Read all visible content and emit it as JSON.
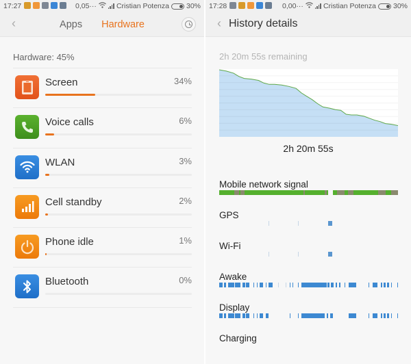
{
  "left_screen": {
    "status_bar": {
      "time": "17:27",
      "notifications": [
        {
          "name": "game-notification-icon",
          "color": "#d89a2a"
        },
        {
          "name": "orange-app-notification-icon",
          "color": "#f0973a"
        },
        {
          "name": "gray-app-notification-icon",
          "color": "#7e8794"
        },
        {
          "name": "blue-app-notification-icon",
          "color": "#3b86d6"
        },
        {
          "name": "message-notification-icon",
          "color": "#6b7d92"
        }
      ],
      "data_speed": "0,05···",
      "carrier": "Cristian Potenza",
      "battery": "30%"
    },
    "header": {
      "back_icon": "‹",
      "tabs": [
        {
          "label": "Apps",
          "active": false
        },
        {
          "label": "Hardware",
          "active": true
        }
      ],
      "history_icon": "clock-icon"
    },
    "section_label": "Hardware: 45%",
    "items": [
      {
        "name": "Screen",
        "percent_label": "34%",
        "percent": 34,
        "icon": "screen-icon",
        "color": "#e9591f"
      },
      {
        "name": "Voice calls",
        "percent_label": "6%",
        "percent": 6,
        "icon": "phone-icon",
        "color": "#4aa024"
      },
      {
        "name": "WLAN",
        "percent_label": "3%",
        "percent": 3,
        "icon": "wifi-icon",
        "color": "#2a7fd8"
      },
      {
        "name": "Cell standby",
        "percent_label": "2%",
        "percent": 2,
        "icon": "signal-bars-icon",
        "color": "#f18a14"
      },
      {
        "name": "Phone idle",
        "percent_label": "1%",
        "percent": 1,
        "icon": "power-icon",
        "color": "#f18a14"
      },
      {
        "name": "Bluetooth",
        "percent_label": "0%",
        "percent": 0,
        "icon": "bluetooth-icon",
        "color": "#2a7fd8"
      }
    ],
    "accent_color": "#e8731e"
  },
  "right_screen": {
    "status_bar": {
      "time": "17:28",
      "notifications": [
        {
          "name": "gray-app-notification-icon",
          "color": "#7e8794"
        },
        {
          "name": "game-notification-icon",
          "color": "#d89a2a"
        },
        {
          "name": "orange-app-notification-icon",
          "color": "#f0973a"
        },
        {
          "name": "blue-app-notification-icon",
          "color": "#3b86d6"
        },
        {
          "name": "message-notification-icon",
          "color": "#6b7d92"
        }
      ],
      "data_speed": "0,00···",
      "carrier": "Cristian Potenza",
      "battery": "30%"
    },
    "header": {
      "back_icon": "‹",
      "title": "History details"
    },
    "remaining_label": "2h 20m 55s remaining",
    "battery_chart": {
      "type": "area",
      "description": "Battery level over time (declining)",
      "x": [
        0,
        0.04,
        0.08,
        0.11,
        0.14,
        0.18,
        0.22,
        0.25,
        0.28,
        0.31,
        0.35,
        0.39,
        0.43,
        0.46,
        0.49,
        0.52,
        0.55,
        0.58,
        0.62,
        0.65,
        0.68,
        0.71,
        0.74,
        0.77,
        0.81,
        0.84,
        0.87,
        0.9,
        0.93,
        0.96,
        1.0
      ],
      "y": [
        1.0,
        0.98,
        0.95,
        0.9,
        0.87,
        0.86,
        0.84,
        0.8,
        0.78,
        0.78,
        0.77,
        0.75,
        0.72,
        0.65,
        0.6,
        0.55,
        0.49,
        0.44,
        0.42,
        0.4,
        0.39,
        0.33,
        0.32,
        0.32,
        0.3,
        0.27,
        0.24,
        0.22,
        0.19,
        0.18,
        0.16
      ],
      "ylim": [
        0,
        1
      ],
      "xlim": [
        0,
        1
      ],
      "grid": true,
      "line_color": "#5fa84a",
      "fill_color": "#c5dff5"
    },
    "total_time": "2h 20m 55s",
    "tracks": [
      {
        "label": "Mobile network signal",
        "segments": [
          {
            "s": 0.0,
            "e": 0.61,
            "c": "#55b02e"
          },
          {
            "s": 0.085,
            "e": 0.11,
            "c": "#8a8a6e"
          },
          {
            "s": 0.12,
            "e": 0.14,
            "c": "#8a8a6e"
          },
          {
            "s": 0.47,
            "e": 0.48,
            "c": "#8a8a6e"
          },
          {
            "s": 0.59,
            "e": 0.6,
            "c": "#8a8a6e"
          },
          {
            "s": 0.637,
            "e": 1.0,
            "c": "#55b02e"
          },
          {
            "s": 0.66,
            "e": 0.7,
            "c": "#8a8a6e"
          },
          {
            "s": 0.72,
            "e": 0.75,
            "c": "#8a8a6e"
          },
          {
            "s": 0.89,
            "e": 0.93,
            "c": "#8a8a6e"
          },
          {
            "s": 0.96,
            "e": 1.0,
            "c": "#8a8a6e"
          }
        ]
      },
      {
        "label": "GPS",
        "segments": [
          {
            "s": 0.275,
            "e": 0.279,
            "c": "#c6d6e6"
          },
          {
            "s": 0.44,
            "e": 0.444,
            "c": "#c6d6e6"
          },
          {
            "s": 0.61,
            "e": 0.632,
            "c": "#5a96cf"
          }
        ]
      },
      {
        "label": "Wi-Fi",
        "segments": [
          {
            "s": 0.275,
            "e": 0.279,
            "c": "#c6d6e6"
          },
          {
            "s": 0.44,
            "e": 0.444,
            "c": "#c6d6e6"
          },
          {
            "s": 0.61,
            "e": 0.632,
            "c": "#5a96cf"
          }
        ]
      },
      {
        "label": "Awake",
        "segments": [
          {
            "s": 0.0,
            "e": 0.02,
            "c": "#3d89d2"
          },
          {
            "s": 0.028,
            "e": 0.04,
            "c": "#3d89d2"
          },
          {
            "s": 0.05,
            "e": 0.085,
            "c": "#3d89d2"
          },
          {
            "s": 0.09,
            "e": 0.12,
            "c": "#3d89d2"
          },
          {
            "s": 0.13,
            "e": 0.145,
            "c": "#3d89d2"
          },
          {
            "s": 0.15,
            "e": 0.17,
            "c": "#3d89d2"
          },
          {
            "s": 0.19,
            "e": 0.195,
            "c": "#3d89d2"
          },
          {
            "s": 0.21,
            "e": 0.215,
            "c": "#3d89d2"
          },
          {
            "s": 0.225,
            "e": 0.245,
            "c": "#3d89d2"
          },
          {
            "s": 0.26,
            "e": 0.265,
            "c": "#3d89d2"
          },
          {
            "s": 0.275,
            "e": 0.3,
            "c": "#3d89d2"
          },
          {
            "s": 0.33,
            "e": 0.334,
            "c": "#c6d6e6"
          },
          {
            "s": 0.37,
            "e": 0.374,
            "c": "#c6d6e6"
          },
          {
            "s": 0.395,
            "e": 0.4,
            "c": "#3d89d2"
          },
          {
            "s": 0.41,
            "e": 0.415,
            "c": "#3d89d2"
          },
          {
            "s": 0.44,
            "e": 0.445,
            "c": "#3d89d2"
          },
          {
            "s": 0.46,
            "e": 0.6,
            "c": "#3d89d2"
          },
          {
            "s": 0.605,
            "e": 0.615,
            "c": "#3d89d2"
          },
          {
            "s": 0.625,
            "e": 0.64,
            "c": "#3d89d2"
          },
          {
            "s": 0.65,
            "e": 0.66,
            "c": "#3d89d2"
          },
          {
            "s": 0.67,
            "e": 0.68,
            "c": "#3d89d2"
          },
          {
            "s": 0.7,
            "e": 0.705,
            "c": "#3d89d2"
          },
          {
            "s": 0.725,
            "e": 0.765,
            "c": "#3d89d2"
          },
          {
            "s": 0.835,
            "e": 0.84,
            "c": "#3d89d2"
          },
          {
            "s": 0.86,
            "e": 0.885,
            "c": "#3d89d2"
          },
          {
            "s": 0.905,
            "e": 0.91,
            "c": "#3d89d2"
          },
          {
            "s": 0.92,
            "e": 0.93,
            "c": "#3d89d2"
          },
          {
            "s": 0.94,
            "e": 0.95,
            "c": "#3d89d2"
          },
          {
            "s": 0.96,
            "e": 0.965,
            "c": "#3d89d2"
          },
          {
            "s": 0.995,
            "e": 1.0,
            "c": "#3d89d2"
          }
        ]
      },
      {
        "label": "Display",
        "segments": [
          {
            "s": 0.0,
            "e": 0.02,
            "c": "#3d89d2"
          },
          {
            "s": 0.028,
            "e": 0.04,
            "c": "#3d89d2"
          },
          {
            "s": 0.05,
            "e": 0.085,
            "c": "#3d89d2"
          },
          {
            "s": 0.09,
            "e": 0.12,
            "c": "#3d89d2"
          },
          {
            "s": 0.13,
            "e": 0.145,
            "c": "#3d89d2"
          },
          {
            "s": 0.15,
            "e": 0.17,
            "c": "#3d89d2"
          },
          {
            "s": 0.19,
            "e": 0.195,
            "c": "#3d89d2"
          },
          {
            "s": 0.21,
            "e": 0.215,
            "c": "#3d89d2"
          },
          {
            "s": 0.225,
            "e": 0.245,
            "c": "#3d89d2"
          },
          {
            "s": 0.26,
            "e": 0.275,
            "c": "#3d89d2"
          },
          {
            "s": 0.395,
            "e": 0.4,
            "c": "#3d89d2"
          },
          {
            "s": 0.44,
            "e": 0.445,
            "c": "#3d89d2"
          },
          {
            "s": 0.46,
            "e": 0.59,
            "c": "#3d89d2"
          },
          {
            "s": 0.6,
            "e": 0.61,
            "c": "#3d89d2"
          },
          {
            "s": 0.62,
            "e": 0.635,
            "c": "#3d89d2"
          },
          {
            "s": 0.725,
            "e": 0.765,
            "c": "#3d89d2"
          },
          {
            "s": 0.835,
            "e": 0.84,
            "c": "#3d89d2"
          },
          {
            "s": 0.86,
            "e": 0.885,
            "c": "#3d89d2"
          },
          {
            "s": 0.905,
            "e": 0.91,
            "c": "#3d89d2"
          },
          {
            "s": 0.92,
            "e": 0.93,
            "c": "#3d89d2"
          },
          {
            "s": 0.94,
            "e": 0.95,
            "c": "#3d89d2"
          },
          {
            "s": 0.96,
            "e": 0.965,
            "c": "#3d89d2"
          },
          {
            "s": 0.995,
            "e": 1.0,
            "c": "#3d89d2"
          }
        ]
      },
      {
        "label": "Charging",
        "segments": []
      }
    ]
  }
}
